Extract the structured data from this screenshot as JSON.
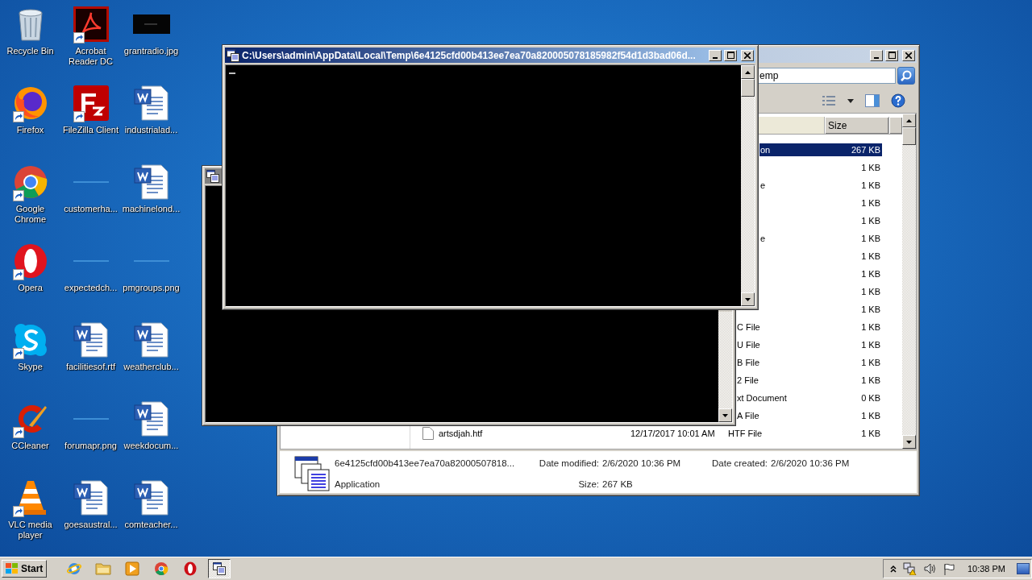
{
  "desktop_icons": [
    {
      "label": "Recycle Bin",
      "kind": "recycle",
      "shortcut": false
    },
    {
      "label": "Acrobat Reader DC",
      "kind": "acrobat",
      "shortcut": true
    },
    {
      "label": "grantradio.jpg",
      "kind": "dark-image",
      "shortcut": false
    },
    {
      "label": "Firefox",
      "kind": "firefox",
      "shortcut": true
    },
    {
      "label": "FileZilla Client",
      "kind": "filezilla",
      "shortcut": true
    },
    {
      "label": "industrialad...",
      "kind": "document",
      "shortcut": false
    },
    {
      "label": "Google Chrome",
      "kind": "chrome",
      "shortcut": true
    },
    {
      "label": "customerha...",
      "kind": "blank-image",
      "shortcut": false
    },
    {
      "label": "machinelond...",
      "kind": "document",
      "shortcut": false
    },
    {
      "label": "Opera",
      "kind": "opera",
      "shortcut": true
    },
    {
      "label": "expectedch...",
      "kind": "blank-image",
      "shortcut": false
    },
    {
      "label": "pmgroups.png",
      "kind": "blank-image",
      "shortcut": false
    },
    {
      "label": "Skype",
      "kind": "skype",
      "shortcut": true
    },
    {
      "label": "facilitiesof.rtf",
      "kind": "document",
      "shortcut": false
    },
    {
      "label": "weatherclub...",
      "kind": "document",
      "shortcut": false
    },
    {
      "label": "CCleaner",
      "kind": "ccleaner",
      "shortcut": true
    },
    {
      "label": "forumapr.png",
      "kind": "blank-image",
      "shortcut": false
    },
    {
      "label": "weekdocum...",
      "kind": "document",
      "shortcut": false
    },
    {
      "label": "VLC media player",
      "kind": "vlc",
      "shortcut": true
    },
    {
      "label": "goesaustral...",
      "kind": "document",
      "shortcut": false
    },
    {
      "label": "comteacher...",
      "kind": "document",
      "shortcut": false
    }
  ],
  "explorer": {
    "active": false,
    "address": "emp",
    "columns": [
      {
        "label": "Size"
      }
    ],
    "rows": [
      {
        "type": "on",
        "size": "267 KB",
        "selected": true
      },
      {
        "size": "1 KB",
        "selected": false
      },
      {
        "type": "e",
        "size": "1 KB",
        "selected": false
      },
      {
        "size": "1 KB",
        "selected": false
      },
      {
        "size": "1 KB",
        "selected": false
      },
      {
        "type": "e",
        "size": "1 KB",
        "selected": false
      },
      {
        "size": "1 KB",
        "selected": false
      },
      {
        "size": "1 KB",
        "selected": false
      },
      {
        "size": "1 KB",
        "selected": false
      },
      {
        "size": "1 KB",
        "selected": false
      },
      {
        "type": "C File",
        "size": "1 KB",
        "selected": false
      },
      {
        "type": "U File",
        "size": "1 KB",
        "selected": false
      },
      {
        "type": "B File",
        "size": "1 KB",
        "selected": false
      },
      {
        "type": "2 File",
        "size": "1 KB",
        "selected": false
      },
      {
        "type": "xt Document",
        "size": "0 KB",
        "selected": false
      },
      {
        "type": "A File",
        "size": "1 KB",
        "selected": false
      },
      {
        "name": "artsdjah.htf",
        "date": "12/17/2017 10:01 AM",
        "type": "HTF File",
        "size": "1 KB",
        "selected": false
      }
    ],
    "details": {
      "name": "6e4125cfd00b413ee7ea70a82000507818...",
      "type": "Application",
      "modified_label": "Date modified:",
      "modified": "2/6/2020 10:36 PM",
      "size_label": "Size:",
      "size": "267 KB",
      "created_label": "Date created:",
      "created": "2/6/2020 10:36 PM"
    }
  },
  "background_console": {
    "active": false
  },
  "console": {
    "title": "C:\\Users\\admin\\AppData\\Local\\Temp\\6e4125cfd00b413ee7ea70a820005078185982f54d1d3bad06d...",
    "active": true
  },
  "taskbar": {
    "start": "Start",
    "apps": [
      {
        "kind": "ie",
        "active": false
      },
      {
        "kind": "folder",
        "active": false
      },
      {
        "kind": "media",
        "active": false
      },
      {
        "kind": "chrome",
        "active": false
      },
      {
        "kind": "opera",
        "active": false
      },
      {
        "kind": "console",
        "active": true
      }
    ],
    "tray": [
      {
        "kind": "chevron"
      },
      {
        "kind": "network"
      },
      {
        "kind": "volume"
      },
      {
        "kind": "flag"
      }
    ],
    "clock": "10:38 PM"
  }
}
